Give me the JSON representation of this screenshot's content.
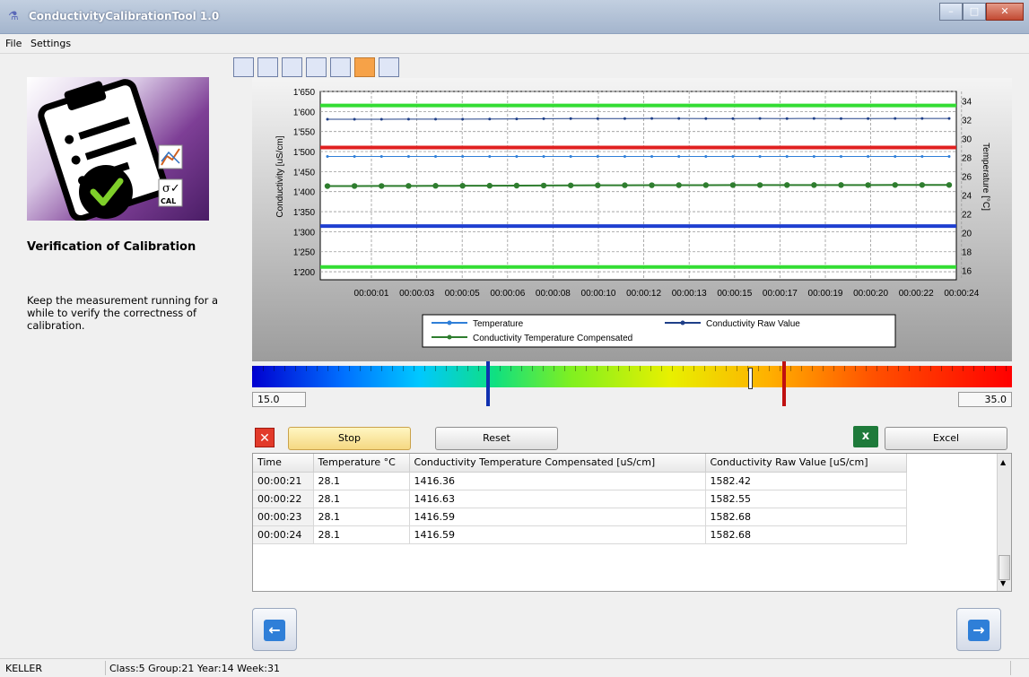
{
  "window": {
    "title": "ConductivityCalibrationTool 1.0"
  },
  "menu": {
    "items": [
      "File",
      "Settings"
    ]
  },
  "left": {
    "heading": "Verification of Calibration",
    "description": "Keep the measurement running for a while to verify the correctness of calibration.",
    "cal_icon_text": "CAL",
    "sigma_text": "σ✓"
  },
  "tabs": {
    "count": 7,
    "active_index": 5
  },
  "chart_data": {
    "type": "line",
    "ylabel_left": "Conductivity [uS/cm]",
    "ylabel_right": "Temperature [°C]",
    "ylim_left": [
      1180,
      1650
    ],
    "ylim_right": [
      15,
      35
    ],
    "yticks_left": [
      "1'650",
      "1'600",
      "1'550",
      "1'500",
      "1'450",
      "1'400",
      "1'350",
      "1'300",
      "1'250",
      "1'200"
    ],
    "yticks_right": [
      "34",
      "32",
      "30",
      "28",
      "26",
      "24",
      "22",
      "20",
      "18",
      "16"
    ],
    "xticks": [
      "00:00:01",
      "00:00:03",
      "00:00:05",
      "00:00:06",
      "00:00:08",
      "00:00:10",
      "00:00:12",
      "00:00:13",
      "00:00:15",
      "00:00:17",
      "00:00:19",
      "00:00:20",
      "00:00:22",
      "00:00:24"
    ],
    "x": [
      1,
      2,
      3,
      4,
      5,
      6,
      7,
      8,
      9,
      10,
      11,
      12,
      13,
      14,
      15,
      16,
      17,
      18,
      19,
      20,
      21,
      22,
      23,
      24
    ],
    "series": [
      {
        "name": "Temperature",
        "axis": "right",
        "color": "#2f7fd8",
        "values": [
          28.1,
          28.1,
          28.1,
          28.1,
          28.1,
          28.1,
          28.1,
          28.1,
          28.1,
          28.1,
          28.1,
          28.1,
          28.1,
          28.1,
          28.1,
          28.1,
          28.1,
          28.1,
          28.1,
          28.1,
          28.1,
          28.1,
          28.1,
          28.1
        ]
      },
      {
        "name": "Conductivity Raw Value",
        "axis": "left",
        "color": "#1f3f88",
        "values": [
          1580.5,
          1580.6,
          1580.7,
          1580.8,
          1580.9,
          1581.0,
          1581.2,
          1581.5,
          1582.0,
          1582.3,
          1582.4,
          1582.4,
          1582.5,
          1582.5,
          1582.4,
          1582.4,
          1582.5,
          1582.4,
          1582.5,
          1582.4,
          1582.42,
          1582.55,
          1582.68,
          1582.68
        ]
      },
      {
        "name": "Conductivity Temperature Compensated",
        "axis": "left",
        "color": "#2e7d2e",
        "values": [
          1413.8,
          1414.0,
          1414.1,
          1414.3,
          1414.5,
          1414.6,
          1414.8,
          1415.0,
          1415.2,
          1415.5,
          1415.7,
          1415.9,
          1416.0,
          1416.1,
          1416.2,
          1416.3,
          1416.3,
          1416.4,
          1416.4,
          1416.4,
          1416.36,
          1416.63,
          1416.59,
          1416.59
        ]
      }
    ],
    "reference_lines": [
      {
        "axis": "left",
        "value": 1615,
        "color": "#33dd33"
      },
      {
        "axis": "left",
        "value": 1510,
        "color": "#e02020"
      },
      {
        "axis": "left",
        "value": 1314,
        "color": "#1f3fd0"
      },
      {
        "axis": "left",
        "value": 1212,
        "color": "#33dd33"
      }
    ],
    "grid": true,
    "legend_position": "bottom-center"
  },
  "colorbar": {
    "min_label": "15.0",
    "max_label": "35.0",
    "min_value": 15.0,
    "max_value": 35.0,
    "blue_marker_value": 21.2,
    "red_marker_value": 29.0,
    "current_value": 28.1
  },
  "controls": {
    "stop_label": "Stop",
    "reset_label": "Reset",
    "excel_label": "Excel"
  },
  "table": {
    "columns": [
      "Time",
      "Temperature °C",
      "Conductivity Temperature Compensated [uS/cm]",
      "Conductivity Raw Value [uS/cm]"
    ],
    "rows": [
      [
        "00:00:21",
        "28.1",
        "1416.36",
        "1582.42"
      ],
      [
        "00:00:22",
        "28.1",
        "1416.63",
        "1582.55"
      ],
      [
        "00:00:23",
        "28.1",
        "1416.59",
        "1582.68"
      ],
      [
        "00:00:24",
        "28.1",
        "1416.59",
        "1582.68"
      ]
    ]
  },
  "status": {
    "left": "KELLER",
    "info": "Class:5 Group:21 Year:14 Week:31"
  }
}
